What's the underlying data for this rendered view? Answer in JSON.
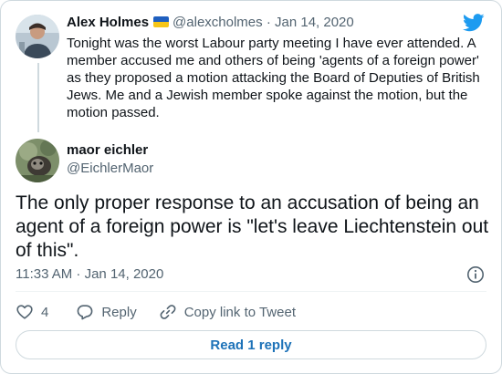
{
  "parent_tweet": {
    "author_name": "Alex Holmes",
    "author_handle": "@alexcholmes",
    "separator": "·",
    "date": "Jan 14, 2020",
    "text": "Tonight was the worst Labour party meeting I have ever attended. A member accused me and others of being 'agents of a foreign power' as they proposed a motion attacking the Board of Deputies of British Jews. Me and a Jewish member spoke against the motion, but the motion passed."
  },
  "main_tweet": {
    "author_name": "maor eichler",
    "author_handle": "@EichlerMaor",
    "text": "The only proper response to an accusation of being an agent of a foreign power is \"let's leave Liechtenstein out of this\".",
    "timestamp": "11:33 AM · Jan 14, 2020"
  },
  "actions": {
    "like_count": "4",
    "reply_label": "Reply",
    "copy_link_label": "Copy link to Tweet"
  },
  "read_replies_label": "Read 1 reply",
  "colors": {
    "twitter_blue": "#1d9bf0",
    "link_blue": "#1d72b8",
    "muted": "#536471",
    "border": "#cfd9de"
  },
  "icons": {
    "brand": "twitter-bird-icon",
    "flag": "ukraine-flag-icon",
    "info": "info-icon",
    "like": "heart-icon",
    "reply": "reply-bubble-icon",
    "copy_link": "link-icon"
  }
}
